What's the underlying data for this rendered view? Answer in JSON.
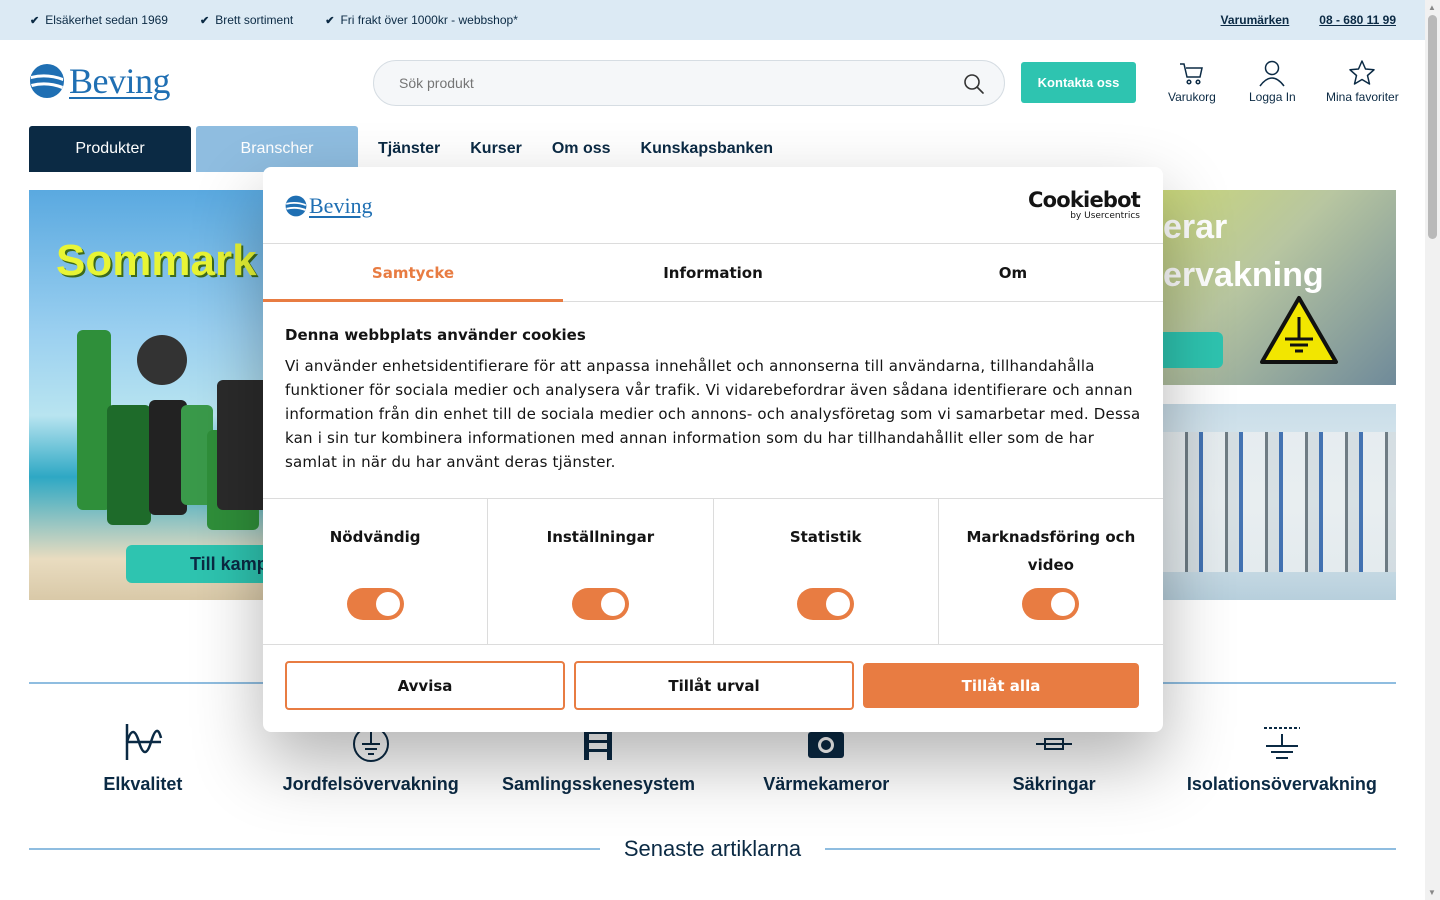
{
  "topbar": {
    "usps": [
      "Elsäkerhet sedan 1969",
      "Brett sortiment",
      "Fri frakt över 1000kr - webbshop*"
    ],
    "brands_link": "Varumärken",
    "phone": "08 - 680 11 99"
  },
  "header": {
    "logo_text": "Beving",
    "search_placeholder": "Sök produkt",
    "contact_label": "Kontakta oss",
    "cart_label": "Varukorg",
    "login_label": "Logga In",
    "favorites_label": "Mina favoriter"
  },
  "nav": {
    "products": "Produkter",
    "industries": "Branscher",
    "links": [
      "Tjänster",
      "Kurser",
      "Om oss",
      "Kunskapsbanken"
    ]
  },
  "banners": {
    "left_title": "Sommark",
    "left_cta": "Till kamp",
    "right_top_line1": "erar",
    "right_top_line2": "ervakning"
  },
  "categories": [
    {
      "label": "Elkvalitet",
      "icon": "power-quality-icon"
    },
    {
      "label": "Jordfelsövervakning",
      "icon": "earth-fault-icon"
    },
    {
      "label": "Samlingsskenesystem",
      "icon": "busbar-icon"
    },
    {
      "label": "Värmekameror",
      "icon": "camera-icon"
    },
    {
      "label": "Säkringar",
      "icon": "fuse-icon"
    },
    {
      "label": "Isolationsövervakning",
      "icon": "insulation-icon"
    }
  ],
  "articles_heading": "Senaste artiklarna",
  "cookie": {
    "logo_text": "Beving",
    "brand": "Cookiebot",
    "brand_sub": "by Usercentrics",
    "tabs": [
      "Samtycke",
      "Information",
      "Om"
    ],
    "title": "Denna webbplats använder cookies",
    "body": "Vi använder enhetsidentifierare för att anpassa innehållet och annonserna till användarna, tillhandahålla funktioner för sociala medier och analysera vår trafik. Vi vidarebefordrar även sådana identifierare och annan information från din enhet till de sociala medier och annons- och analysföretag som vi samarbetar med. Dessa kan i sin tur kombinera informationen med annan information som du har tillhandahållit eller som de har samlat in när du har använt deras tjänster.",
    "categories": [
      "Nödvändig",
      "Inställningar",
      "Statistik",
      "Marknadsföring och video"
    ],
    "btn_reject": "Avvisa",
    "btn_select": "Tillåt urval",
    "btn_all": "Tillåt alla"
  },
  "colors": {
    "navy": "#0b2a44",
    "teal": "#2ec4b0",
    "light_blue": "#8fbde0",
    "cookie_orange": "#e87c42"
  }
}
